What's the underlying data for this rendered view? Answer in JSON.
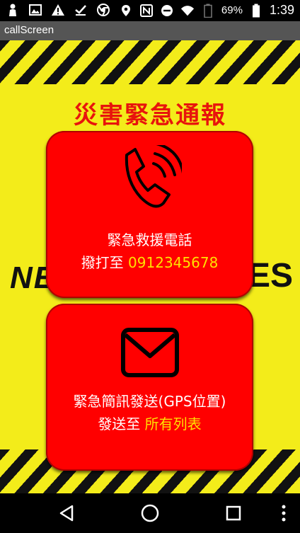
{
  "status_bar": {
    "left_icons": [
      "person-icon",
      "image-icon",
      "warning-icon",
      "download-done-icon",
      "chrome-icon"
    ],
    "right_icons": [
      "location-icon",
      "nfc-icon",
      "do-not-disturb-icon",
      "wifi-icon",
      "battery-outline-icon",
      "battery-icon"
    ],
    "battery_percent": "69%",
    "time": "1:39"
  },
  "app_bar": {
    "title": "callScreen"
  },
  "page": {
    "title": "災害緊急通報",
    "background_text_left": "NE",
    "background_text_right": "ES"
  },
  "call_card": {
    "icon": "phone-ringing-icon",
    "line1": "緊急救援電話",
    "line2_prefix": "撥打至",
    "phone_number": "0912345678"
  },
  "sms_card": {
    "icon": "envelope-icon",
    "line1": "緊急簡訊發送(GPS位置)",
    "line2_prefix": "發送至",
    "recipients": "所有列表"
  },
  "nav_bar": {
    "buttons": [
      "back-icon",
      "home-icon",
      "recents-icon",
      "menu-icon"
    ]
  },
  "colors": {
    "title_red": "#e8140c",
    "card_red": "#ff0000",
    "highlight_yellow": "#ffe100",
    "background_yellow": "#f3ec1a",
    "app_bar_gray": "#555555"
  }
}
